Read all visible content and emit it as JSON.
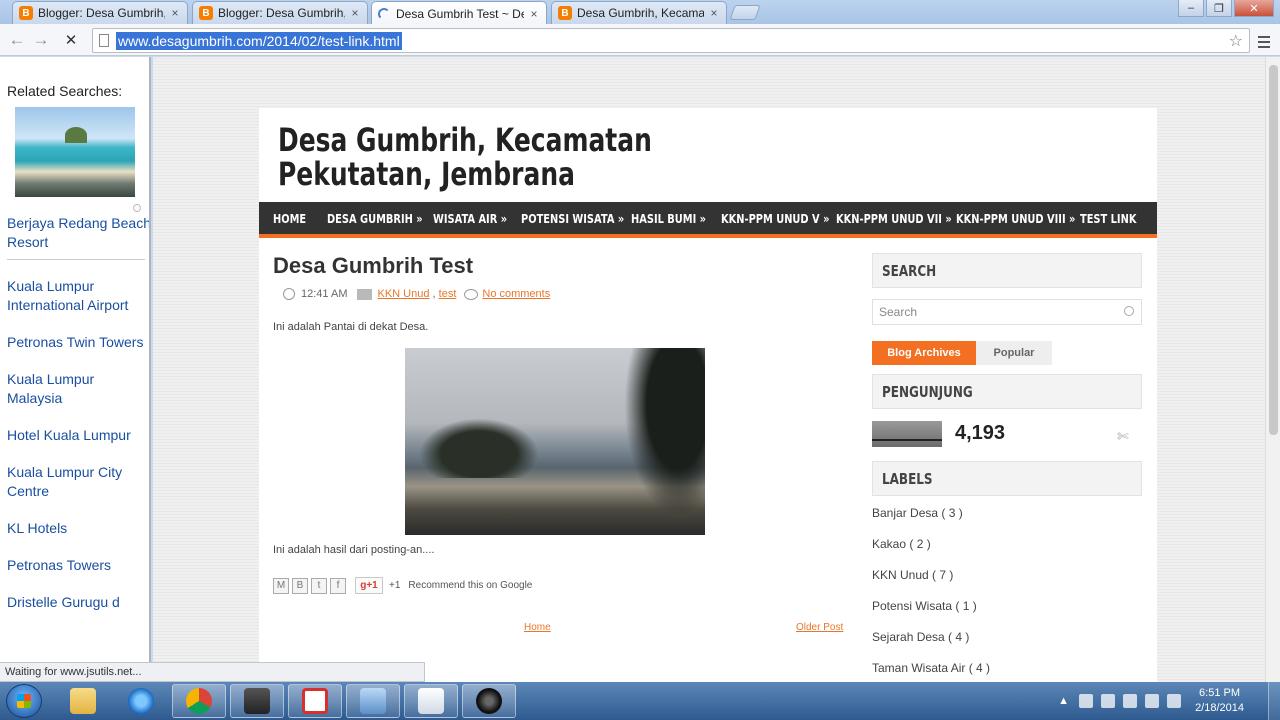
{
  "browser": {
    "tabs": [
      {
        "title": "Blogger: Desa Gumbrih, K",
        "icon": "blogger-icon",
        "active": false
      },
      {
        "title": "Blogger: Desa Gumbrih, K",
        "icon": "blogger-icon",
        "active": false
      },
      {
        "title": "Desa Gumbrih Test ~ Desa",
        "icon": "loading-spinner-icon",
        "active": true
      },
      {
        "title": "Desa Gumbrih, Kecamatan",
        "icon": "blogger-icon",
        "active": false
      }
    ],
    "tab_close": "×",
    "url": "www.desagumbrih.com/2014/02/test-link.html",
    "status_text": "Waiting for www.jsutils.net..."
  },
  "related": {
    "heading": "Related Searches:",
    "items": [
      "Berjaya Redang Beach Resort",
      "Kuala Lumpur International Airport",
      "Petronas Twin Towers",
      "Kuala Lumpur Malaysia",
      "Hotel Kuala Lumpur",
      "Kuala Lumpur City Centre",
      "KL Hotels",
      "Petronas Towers",
      "Dristelle Gurugu d"
    ]
  },
  "blog": {
    "title": "Desa Gumbrih, Kecamatan Pekutatan, Jembrana",
    "nav": [
      {
        "label": "HOME",
        "arrow": ""
      },
      {
        "label": "DESA GUMBRIH",
        "arrow": "»"
      },
      {
        "label": "WISATA AIR",
        "arrow": "»"
      },
      {
        "label": "POTENSI WISATA",
        "arrow": "»"
      },
      {
        "label": "HASIL BUMI",
        "arrow": "»"
      },
      {
        "label": "KKN-PPM UNUD V",
        "arrow": "»"
      },
      {
        "label": "KKN-PPM UNUD VII",
        "arrow": "»"
      },
      {
        "label": "KKN-PPM UNUD VIII",
        "arrow": "»"
      },
      {
        "label": "TEST LINK",
        "arrow": ""
      }
    ],
    "post": {
      "title": "Desa Gumbrih Test",
      "time": "12:41 AM",
      "label1": "KKN Unud",
      "label_sep": " , ",
      "label2": "test",
      "comments": "No comments",
      "para1": "Ini adalah Pantai di dekat Desa.",
      "para2": "Ini adalah hasil dari posting-an....",
      "gplus": "g+1",
      "plus_count": "+1",
      "recommend": "Recommend this on Google"
    },
    "pager": {
      "home": "Home",
      "older": "Older Post"
    },
    "sidebar": {
      "search_heading": "SEARCH",
      "search_placeholder": "Search",
      "tab_archives": "Blog Archives",
      "tab_popular": "Popular",
      "visitors_heading": "PENGUNJUNG",
      "visitor_count": "4,193",
      "labels_heading": "LABELS",
      "labels": [
        "Banjar Desa ( 3 )",
        "Kakao ( 2 )",
        "KKN Unud ( 7 )",
        "Potensi Wisata ( 1 )",
        "Sejarah Desa ( 4 )",
        "Taman Wisata Air ( 4 )"
      ]
    }
  },
  "taskbar": {
    "time": "6:51 PM",
    "date": "2/18/2014"
  }
}
